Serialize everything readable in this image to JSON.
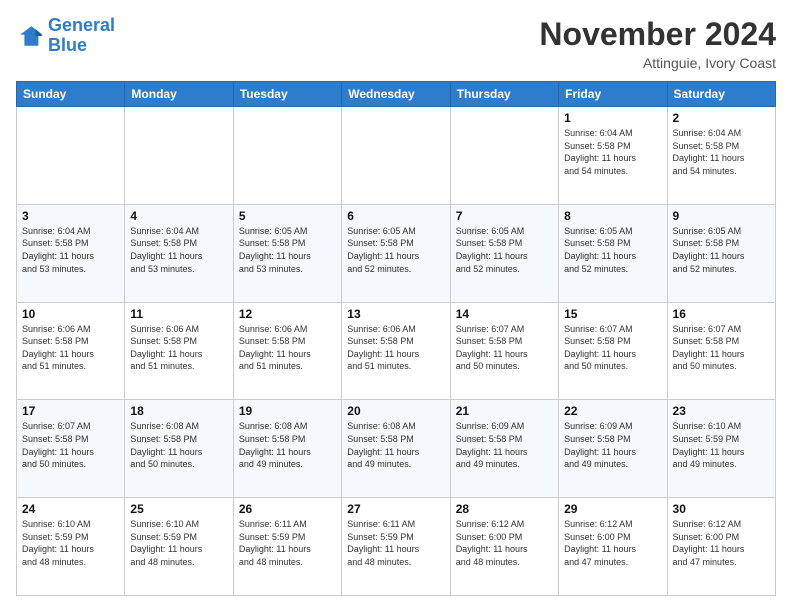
{
  "logo": {
    "line1": "General",
    "line2": "Blue"
  },
  "header": {
    "month": "November 2024",
    "location": "Attinguie, Ivory Coast"
  },
  "weekdays": [
    "Sunday",
    "Monday",
    "Tuesday",
    "Wednesday",
    "Thursday",
    "Friday",
    "Saturday"
  ],
  "weeks": [
    [
      {
        "day": "",
        "info": ""
      },
      {
        "day": "",
        "info": ""
      },
      {
        "day": "",
        "info": ""
      },
      {
        "day": "",
        "info": ""
      },
      {
        "day": "",
        "info": ""
      },
      {
        "day": "1",
        "info": "Sunrise: 6:04 AM\nSunset: 5:58 PM\nDaylight: 11 hours\nand 54 minutes."
      },
      {
        "day": "2",
        "info": "Sunrise: 6:04 AM\nSunset: 5:58 PM\nDaylight: 11 hours\nand 54 minutes."
      }
    ],
    [
      {
        "day": "3",
        "info": "Sunrise: 6:04 AM\nSunset: 5:58 PM\nDaylight: 11 hours\nand 53 minutes."
      },
      {
        "day": "4",
        "info": "Sunrise: 6:04 AM\nSunset: 5:58 PM\nDaylight: 11 hours\nand 53 minutes."
      },
      {
        "day": "5",
        "info": "Sunrise: 6:05 AM\nSunset: 5:58 PM\nDaylight: 11 hours\nand 53 minutes."
      },
      {
        "day": "6",
        "info": "Sunrise: 6:05 AM\nSunset: 5:58 PM\nDaylight: 11 hours\nand 52 minutes."
      },
      {
        "day": "7",
        "info": "Sunrise: 6:05 AM\nSunset: 5:58 PM\nDaylight: 11 hours\nand 52 minutes."
      },
      {
        "day": "8",
        "info": "Sunrise: 6:05 AM\nSunset: 5:58 PM\nDaylight: 11 hours\nand 52 minutes."
      },
      {
        "day": "9",
        "info": "Sunrise: 6:05 AM\nSunset: 5:58 PM\nDaylight: 11 hours\nand 52 minutes."
      }
    ],
    [
      {
        "day": "10",
        "info": "Sunrise: 6:06 AM\nSunset: 5:58 PM\nDaylight: 11 hours\nand 51 minutes."
      },
      {
        "day": "11",
        "info": "Sunrise: 6:06 AM\nSunset: 5:58 PM\nDaylight: 11 hours\nand 51 minutes."
      },
      {
        "day": "12",
        "info": "Sunrise: 6:06 AM\nSunset: 5:58 PM\nDaylight: 11 hours\nand 51 minutes."
      },
      {
        "day": "13",
        "info": "Sunrise: 6:06 AM\nSunset: 5:58 PM\nDaylight: 11 hours\nand 51 minutes."
      },
      {
        "day": "14",
        "info": "Sunrise: 6:07 AM\nSunset: 5:58 PM\nDaylight: 11 hours\nand 50 minutes."
      },
      {
        "day": "15",
        "info": "Sunrise: 6:07 AM\nSunset: 5:58 PM\nDaylight: 11 hours\nand 50 minutes."
      },
      {
        "day": "16",
        "info": "Sunrise: 6:07 AM\nSunset: 5:58 PM\nDaylight: 11 hours\nand 50 minutes."
      }
    ],
    [
      {
        "day": "17",
        "info": "Sunrise: 6:07 AM\nSunset: 5:58 PM\nDaylight: 11 hours\nand 50 minutes."
      },
      {
        "day": "18",
        "info": "Sunrise: 6:08 AM\nSunset: 5:58 PM\nDaylight: 11 hours\nand 50 minutes."
      },
      {
        "day": "19",
        "info": "Sunrise: 6:08 AM\nSunset: 5:58 PM\nDaylight: 11 hours\nand 49 minutes."
      },
      {
        "day": "20",
        "info": "Sunrise: 6:08 AM\nSunset: 5:58 PM\nDaylight: 11 hours\nand 49 minutes."
      },
      {
        "day": "21",
        "info": "Sunrise: 6:09 AM\nSunset: 5:58 PM\nDaylight: 11 hours\nand 49 minutes."
      },
      {
        "day": "22",
        "info": "Sunrise: 6:09 AM\nSunset: 5:58 PM\nDaylight: 11 hours\nand 49 minutes."
      },
      {
        "day": "23",
        "info": "Sunrise: 6:10 AM\nSunset: 5:59 PM\nDaylight: 11 hours\nand 49 minutes."
      }
    ],
    [
      {
        "day": "24",
        "info": "Sunrise: 6:10 AM\nSunset: 5:59 PM\nDaylight: 11 hours\nand 48 minutes."
      },
      {
        "day": "25",
        "info": "Sunrise: 6:10 AM\nSunset: 5:59 PM\nDaylight: 11 hours\nand 48 minutes."
      },
      {
        "day": "26",
        "info": "Sunrise: 6:11 AM\nSunset: 5:59 PM\nDaylight: 11 hours\nand 48 minutes."
      },
      {
        "day": "27",
        "info": "Sunrise: 6:11 AM\nSunset: 5:59 PM\nDaylight: 11 hours\nand 48 minutes."
      },
      {
        "day": "28",
        "info": "Sunrise: 6:12 AM\nSunset: 6:00 PM\nDaylight: 11 hours\nand 48 minutes."
      },
      {
        "day": "29",
        "info": "Sunrise: 6:12 AM\nSunset: 6:00 PM\nDaylight: 11 hours\nand 47 minutes."
      },
      {
        "day": "30",
        "info": "Sunrise: 6:12 AM\nSunset: 6:00 PM\nDaylight: 11 hours\nand 47 minutes."
      }
    ]
  ]
}
